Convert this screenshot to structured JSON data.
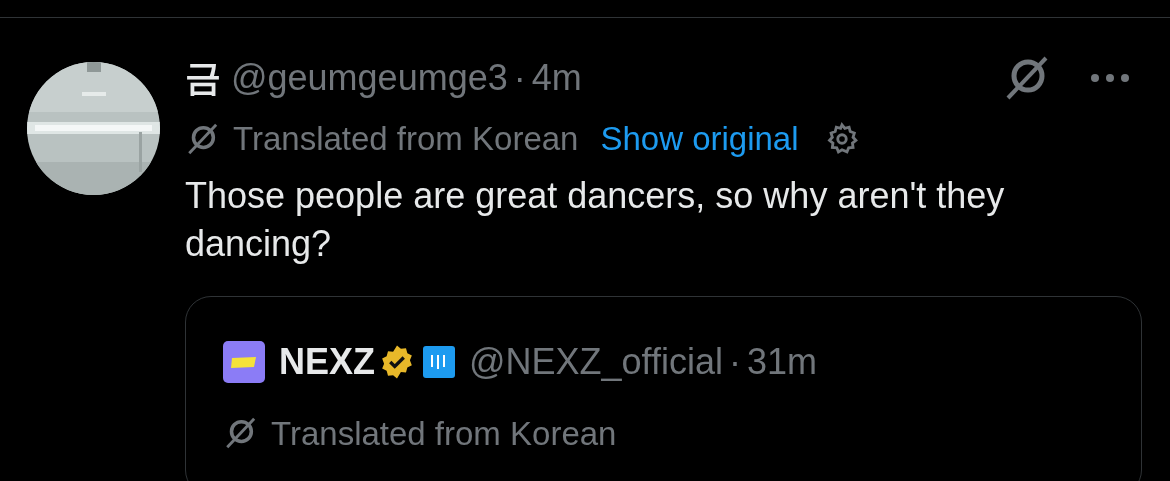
{
  "post": {
    "display_name": "금",
    "handle": "@geumgeumge3",
    "separator": "·",
    "time": "4m",
    "translation": {
      "label": "Translated from Korean",
      "show_original": "Show original"
    },
    "text": "Those people are great dancers, so why aren't they dancing?"
  },
  "quoted_post": {
    "display_name": "NEXZ",
    "verified": true,
    "affiliate_badge": true,
    "handle": "@NEXZ_official",
    "separator": "·",
    "time": "31m",
    "translation": {
      "label": "Translated from Korean"
    }
  }
}
